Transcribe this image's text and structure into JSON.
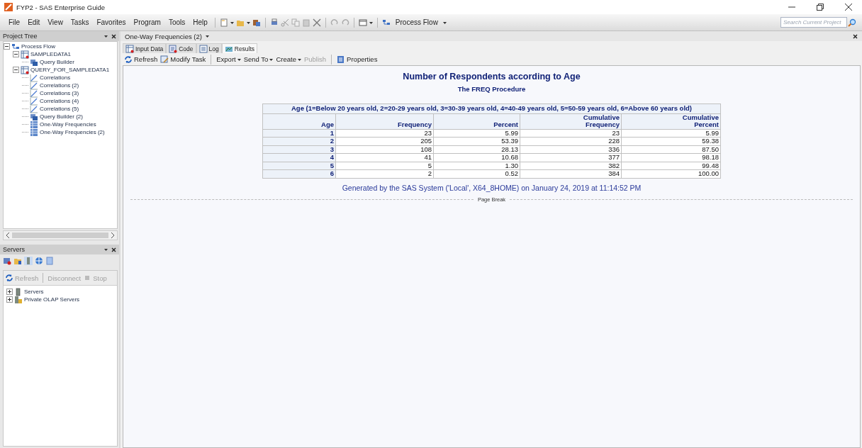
{
  "window": {
    "title": "FYP2 - SAS Enterprise Guide"
  },
  "menu": [
    "File",
    "Edit",
    "View",
    "Tasks",
    "Favorites",
    "Program",
    "Tools",
    "Help"
  ],
  "toolbar": {
    "process_flow": "Process Flow"
  },
  "search": {
    "placeholder": "Search Current Project"
  },
  "project_tree": {
    "title": "Project Tree",
    "items": [
      {
        "label": "Process Flow",
        "kind": "flow",
        "expanded": true,
        "children": [
          {
            "label": "SAMPLEDATA1",
            "kind": "dataset",
            "expanded": true,
            "children": [
              {
                "label": "Query Builder",
                "kind": "query"
              }
            ]
          },
          {
            "label": "QUERY_FOR_SAMPLEDATA1",
            "kind": "dataset",
            "expanded": true,
            "children": [
              {
                "label": "Correlations",
                "kind": "chart"
              },
              {
                "label": "Correlations (2)",
                "kind": "chart"
              },
              {
                "label": "Correlations (3)",
                "kind": "chart"
              },
              {
                "label": "Correlations (4)",
                "kind": "chart"
              },
              {
                "label": "Correlations (5)",
                "kind": "chart"
              },
              {
                "label": "Query Builder (2)",
                "kind": "query"
              },
              {
                "label": "One-Way Frequencies",
                "kind": "grid"
              },
              {
                "label": "One-Way Frequencies (2)",
                "kind": "grid"
              }
            ]
          }
        ]
      }
    ]
  },
  "servers": {
    "title": "Servers",
    "actions": [
      {
        "label": "Refresh",
        "kind": "refresh",
        "disabled": true
      },
      {
        "label": "Disconnect",
        "kind": "plain",
        "disabled": true
      },
      {
        "label": "Stop",
        "kind": "stop",
        "disabled": true
      }
    ],
    "items": [
      {
        "label": "Servers",
        "kind": "server",
        "expanded": false
      },
      {
        "label": "Private OLAP Servers",
        "kind": "olap",
        "expanded": false
      }
    ]
  },
  "document": {
    "title": "One-Way Frequencies (2)",
    "tabs": [
      {
        "label": "Input Data",
        "kind": "data",
        "selected": false
      },
      {
        "label": "Code",
        "kind": "code",
        "selected": false
      },
      {
        "label": "Log",
        "kind": "log",
        "selected": false
      },
      {
        "label": "Results",
        "kind": "results",
        "selected": true
      }
    ],
    "actions": [
      {
        "label": "Refresh",
        "kind": "refresh",
        "disabled": false,
        "dropdown": false
      },
      {
        "label": "Modify Task",
        "kind": "modify",
        "disabled": false,
        "dropdown": false
      },
      {
        "label": "Export",
        "kind": "plain",
        "disabled": false,
        "dropdown": true
      },
      {
        "label": "Send To",
        "kind": "plain",
        "disabled": false,
        "dropdown": true
      },
      {
        "label": "Create",
        "kind": "plain",
        "disabled": false,
        "dropdown": true
      },
      {
        "label": "Publish",
        "kind": "plain",
        "disabled": true,
        "dropdown": false
      },
      {
        "label": "Properties",
        "kind": "properties",
        "disabled": false,
        "dropdown": false
      }
    ]
  },
  "report": {
    "title": "Number of Respondents according to Age",
    "subtitle": "The FREQ Procedure",
    "caption": "Age (1=Below 20 years old, 2=20-29 years old, 3=30-39 years old, 4=40-49 years old, 5=50-59 years old, 6=Above 60 years old)",
    "columns": [
      "Age",
      "Frequency",
      "Percent",
      "Cumulative Frequency",
      "Cumulative Percent"
    ],
    "rows": [
      [
        "1",
        "23",
        "5.99",
        "23",
        "5.99"
      ],
      [
        "2",
        "205",
        "53.39",
        "228",
        "59.38"
      ],
      [
        "3",
        "108",
        "28.13",
        "336",
        "87.50"
      ],
      [
        "4",
        "41",
        "10.68",
        "377",
        "98.18"
      ],
      [
        "5",
        "5",
        "1.30",
        "382",
        "99.48"
      ],
      [
        "6",
        "2",
        "0.52",
        "384",
        "100.00"
      ]
    ],
    "footer": "Generated by the SAS System ('Local', X64_8HOME) on January 24, 2019 at 11:14:52 PM",
    "page_break": "Page Break"
  }
}
